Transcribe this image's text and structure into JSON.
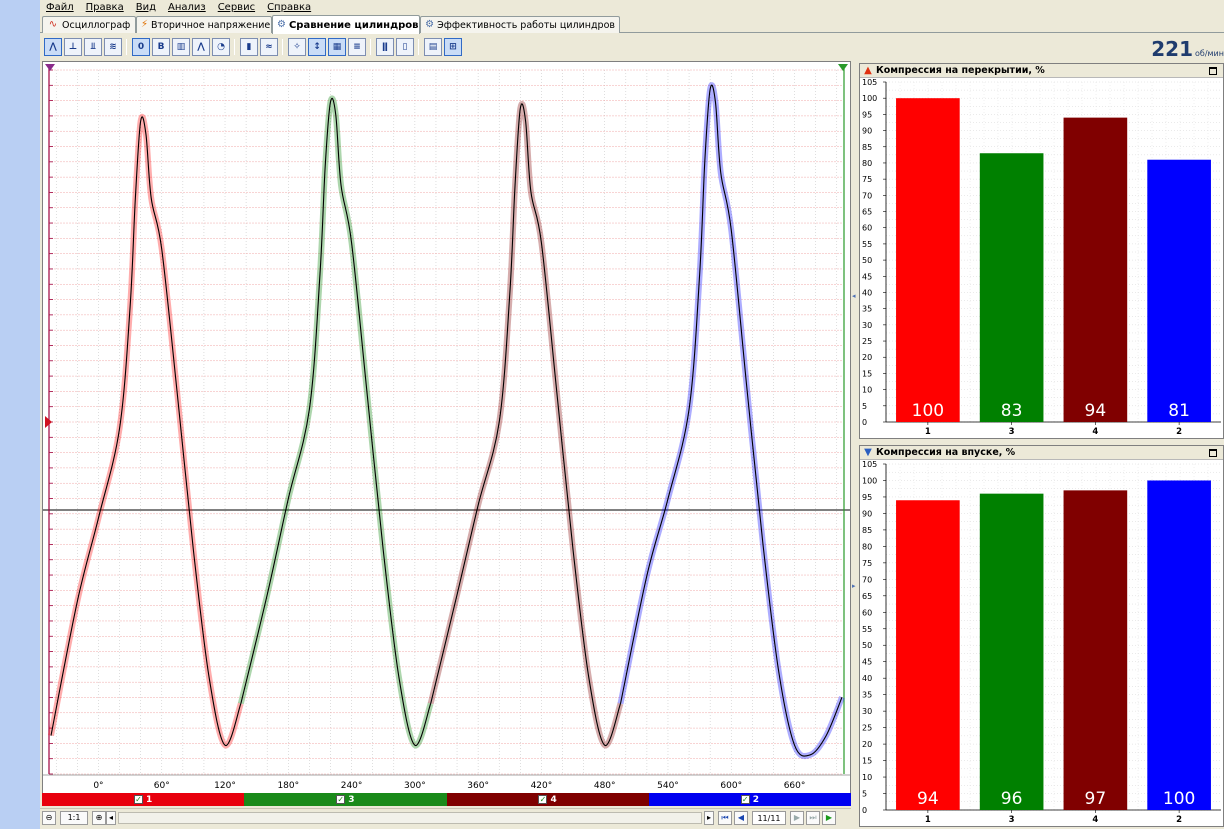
{
  "menu": [
    "Файл",
    "Правка",
    "Вид",
    "Анализ",
    "Сервис",
    "Справка"
  ],
  "tabs": [
    {
      "label": "Осциллограф",
      "icon": "waveform-icon",
      "active": false
    },
    {
      "label": "Вторичное напряжение",
      "icon": "ignition-icon",
      "active": false
    },
    {
      "label": "Сравнение цилиндров",
      "icon": "compare-gear-icon",
      "active": true
    },
    {
      "label": "Эффективность работы цилиндров",
      "icon": "efficiency-gear-icon",
      "active": false
    }
  ],
  "toolbar": {
    "buttons": [
      "waveform-a",
      "waveform-b",
      "waveform-c",
      "waveform-d",
      "offset-toggle",
      "bold-toggle",
      "bar-mode",
      "pulse-mode",
      "rpm-gauge",
      "bar-chart",
      "overlay",
      "marker",
      "align",
      "color-map",
      "layer",
      "scale",
      "column",
      "sort",
      "export",
      "fit"
    ],
    "rpm_value": "221",
    "rpm_unit": "об/мин"
  },
  "plot": {
    "x_tick_labels": [
      "0°",
      "60°",
      "120°",
      "180°",
      "240°",
      "300°",
      "360°",
      "420°",
      "480°",
      "540°",
      "600°",
      "660°"
    ],
    "cylinders": [
      {
        "label": "1",
        "color": "#ff0000",
        "checked": true
      },
      {
        "label": "3",
        "color": "#008000",
        "checked": true
      },
      {
        "label": "4",
        "color": "#800000",
        "checked": true
      },
      {
        "label": "2",
        "color": "#0000ff",
        "checked": true
      }
    ],
    "zoom": "1:1",
    "page": "11/11"
  },
  "chart_data": [
    {
      "type": "line",
      "x_unit": "degrees",
      "xlim": [
        -45,
        705
      ],
      "x_ticks": [
        0,
        60,
        120,
        180,
        240,
        300,
        360,
        420,
        480,
        540,
        600,
        660
      ],
      "series": [
        {
          "name": "1",
          "color": "#ff0000",
          "x": [
            -45,
            -20,
            0,
            20,
            30,
            35,
            40,
            45,
            50,
            60,
            75,
            90,
            105,
            120,
            135
          ],
          "y": [
            3,
            24,
            37,
            51,
            70,
            87,
            99,
            97,
            87,
            79,
            56,
            32,
            12,
            1.5,
            8
          ]
        },
        {
          "name": "3",
          "color": "#008000",
          "x": [
            135,
            160,
            180,
            200,
            210,
            215,
            220,
            225,
            230,
            240,
            255,
            270,
            285,
            300,
            315
          ],
          "y": [
            8,
            25,
            40,
            54,
            75,
            92,
            102,
            100,
            89,
            80,
            56,
            32,
            12,
            1.5,
            8
          ]
        },
        {
          "name": "4",
          "color": "#800000",
          "x": [
            315,
            340,
            360,
            380,
            390,
            395,
            400,
            405,
            410,
            420,
            435,
            450,
            465,
            480,
            495
          ],
          "y": [
            8,
            25,
            39,
            52,
            72,
            89,
            101,
            99,
            88,
            80,
            56,
            32,
            12,
            1.5,
            8
          ]
        },
        {
          "name": "2",
          "color": "#0000ff",
          "x": [
            495,
            520,
            540,
            560,
            570,
            575,
            580,
            585,
            590,
            600,
            615,
            630,
            645,
            660,
            675,
            690,
            705
          ],
          "y": [
            8,
            28,
            40,
            54,
            75,
            93,
            104,
            102,
            91,
            82,
            57,
            33,
            13,
            1.5,
            0,
            3,
            9
          ]
        }
      ]
    },
    {
      "type": "bar",
      "title": "Компрессия на перекрытии, %",
      "categories": [
        "1",
        "3",
        "4",
        "2"
      ],
      "values": [
        100,
        83,
        94,
        81
      ],
      "colors": [
        "#ff0000",
        "#008000",
        "#800000",
        "#0000ff"
      ],
      "ylim": [
        0,
        105
      ],
      "y_ticks": [
        0,
        5,
        10,
        15,
        20,
        25,
        30,
        35,
        40,
        45,
        50,
        55,
        60,
        65,
        70,
        75,
        80,
        85,
        90,
        95,
        100,
        105
      ]
    },
    {
      "type": "bar",
      "title": "Компрессия на впуске, %",
      "categories": [
        "1",
        "3",
        "4",
        "2"
      ],
      "values": [
        94,
        96,
        97,
        100
      ],
      "colors": [
        "#ff0000",
        "#008000",
        "#800000",
        "#0000ff"
      ],
      "ylim": [
        0,
        105
      ],
      "y_ticks": [
        0,
        5,
        10,
        15,
        20,
        25,
        30,
        35,
        40,
        45,
        50,
        55,
        60,
        65,
        70,
        75,
        80,
        85,
        90,
        95,
        100,
        105
      ]
    }
  ]
}
